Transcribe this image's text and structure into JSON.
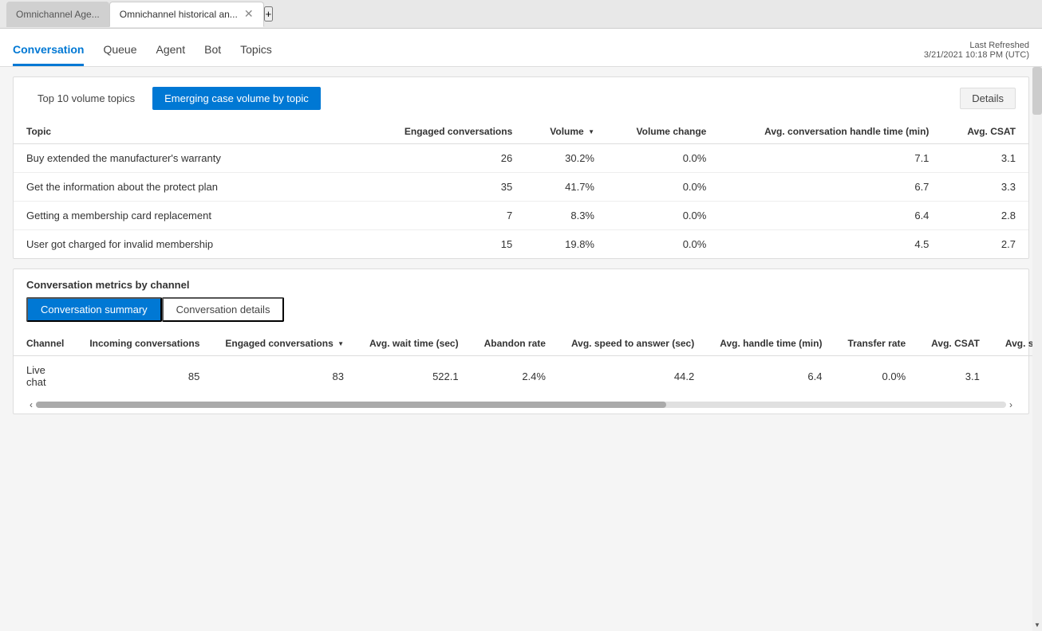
{
  "browser": {
    "tab_inactive_label": "Omnichannel Age...",
    "tab_active_label": "Omnichannel historical an...",
    "tab_add": "+"
  },
  "nav": {
    "tabs": [
      {
        "id": "conversation",
        "label": "Conversation",
        "active": true
      },
      {
        "id": "queue",
        "label": "Queue",
        "active": false
      },
      {
        "id": "agent",
        "label": "Agent",
        "active": false
      },
      {
        "id": "bot",
        "label": "Bot",
        "active": false
      },
      {
        "id": "topics",
        "label": "Topics",
        "active": false
      }
    ],
    "last_refreshed_label": "Last Refreshed",
    "last_refreshed_value": "3/21/2021 10:18 PM (UTC)"
  },
  "topics_card": {
    "tab_inactive_label": "Top 10 volume topics",
    "tab_active_label": "Emerging case volume by topic",
    "details_label": "Details",
    "columns": {
      "topic": "Topic",
      "engaged": "Engaged conversations",
      "volume": "Volume",
      "volume_change": "Volume change",
      "avg_handle": "Avg. conversation handle time (min)",
      "avg_csat": "Avg. CSAT"
    },
    "rows": [
      {
        "topic": "Buy extended the manufacturer's warranty",
        "engaged": "26",
        "volume": "30.2%",
        "volume_change": "0.0%",
        "avg_handle": "7.1",
        "avg_csat": "3.1"
      },
      {
        "topic": "Get the information about the protect plan",
        "engaged": "35",
        "volume": "41.7%",
        "volume_change": "0.0%",
        "avg_handle": "6.7",
        "avg_csat": "3.3"
      },
      {
        "topic": "Getting a membership card replacement",
        "engaged": "7",
        "volume": "8.3%",
        "volume_change": "0.0%",
        "avg_handle": "6.4",
        "avg_csat": "2.8"
      },
      {
        "topic": "User got charged for invalid membership",
        "engaged": "15",
        "volume": "19.8%",
        "volume_change": "0.0%",
        "avg_handle": "4.5",
        "avg_csat": "2.7"
      }
    ]
  },
  "metrics_card": {
    "section_title": "Conversation metrics by channel",
    "tab_active_label": "Conversation summary",
    "tab_inactive_label": "Conversation details",
    "columns": {
      "channel": "Channel",
      "incoming": "Incoming conversations",
      "engaged": "Engaged conversations",
      "avg_wait": "Avg. wait time (sec)",
      "abandon": "Abandon rate",
      "avg_speed": "Avg. speed to answer (sec)",
      "avg_handle": "Avg. handle time (min)",
      "transfer": "Transfer rate",
      "avg_csat": "Avg. CSAT",
      "avg_survey": "Avg. survey se"
    },
    "rows": [
      {
        "channel": "Live chat",
        "incoming": "85",
        "engaged": "83",
        "avg_wait": "522.1",
        "abandon": "2.4%",
        "avg_speed": "44.2",
        "avg_handle": "6.4",
        "transfer": "0.0%",
        "avg_csat": "3.1",
        "avg_survey": ""
      }
    ]
  }
}
